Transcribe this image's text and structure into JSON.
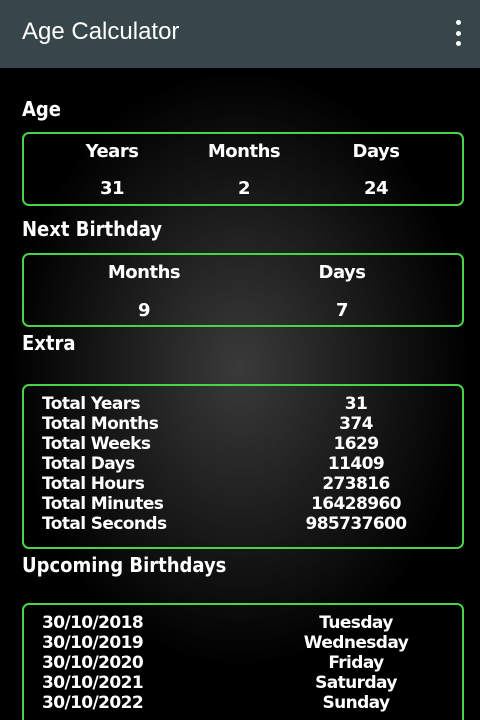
{
  "app": {
    "title": "Age Calculator"
  },
  "age": {
    "title": "Age",
    "headers": [
      "Years",
      "Months",
      "Days"
    ],
    "values": [
      "31",
      "2",
      "24"
    ]
  },
  "next_birthday": {
    "title": "Next Birthday",
    "headers": [
      "Months",
      "Days"
    ],
    "values": [
      "9",
      "7"
    ]
  },
  "extra": {
    "title": "Extra",
    "rows": [
      {
        "label": "Total Years",
        "value": "31"
      },
      {
        "label": "Total Months",
        "value": "374"
      },
      {
        "label": "Total Weeks",
        "value": "1629"
      },
      {
        "label": "Total Days",
        "value": "11409"
      },
      {
        "label": "Total Hours",
        "value": "273816"
      },
      {
        "label": "Total Minutes",
        "value": "16428960"
      },
      {
        "label": "Total Seconds",
        "value": "985737600"
      }
    ]
  },
  "upcoming": {
    "title": "Upcoming Birthdays",
    "rows": [
      {
        "date": "30/10/2018",
        "day": "Tuesday"
      },
      {
        "date": "30/10/2019",
        "day": "Wednesday"
      },
      {
        "date": "30/10/2020",
        "day": "Friday"
      },
      {
        "date": "30/10/2021",
        "day": "Saturday"
      },
      {
        "date": "30/10/2022",
        "day": "Sunday"
      }
    ]
  },
  "colors": {
    "appbar": "#37464a",
    "card_border": "#4ad24a",
    "background": "#000000"
  }
}
